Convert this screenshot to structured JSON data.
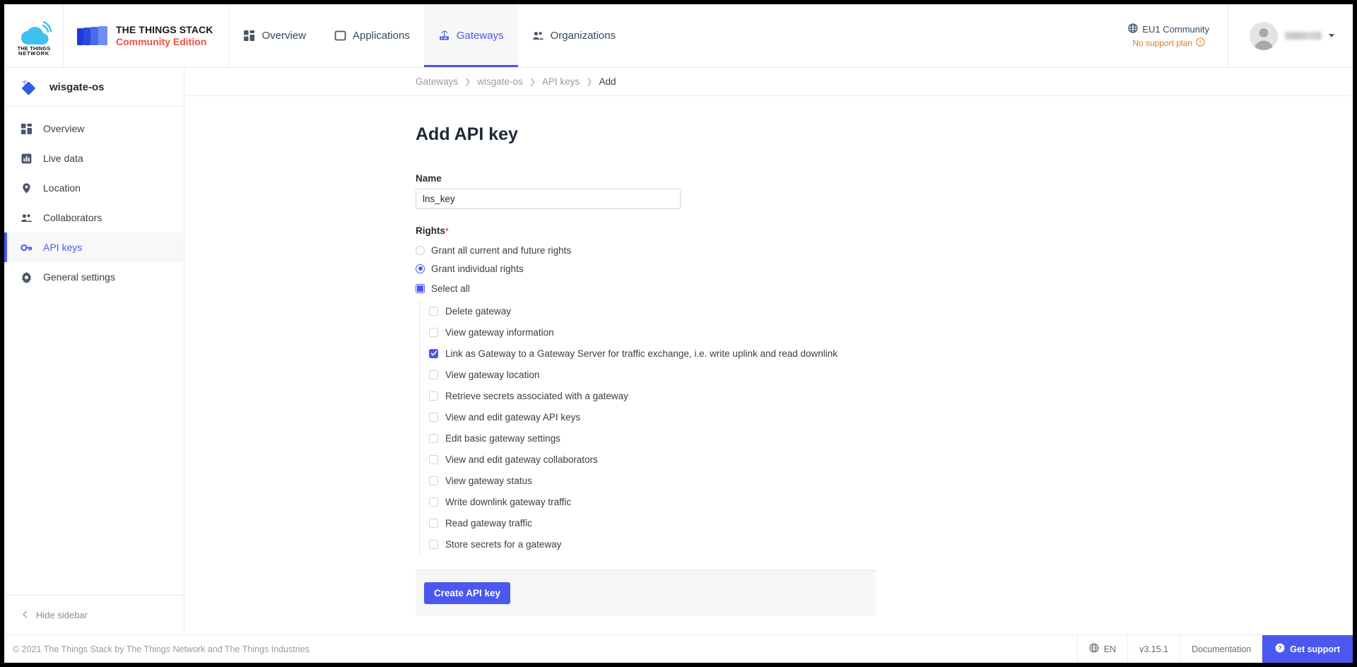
{
  "header": {
    "brand_logo_name": "the-things-network-logo",
    "brand_logo_line1": "THE THINGS",
    "brand_logo_line2": "NETWORK",
    "stack_logo_line1": "THE THINGS STACK",
    "stack_logo_line2": "Community Edition",
    "nav": [
      {
        "label": "Overview",
        "icon": "overview-grid-icon",
        "active": false
      },
      {
        "label": "Applications",
        "icon": "application-square-icon",
        "active": false
      },
      {
        "label": "Gateways",
        "icon": "gateway-router-icon",
        "active": true
      },
      {
        "label": "Organizations",
        "icon": "organizations-people-icon",
        "active": false
      }
    ],
    "cluster": {
      "icon": "globe-icon",
      "name": "EU1 Community",
      "support_plan": "No support plan",
      "help_icon": "question-circle-icon"
    },
    "user": {
      "avatar_icon": "avatar-icon",
      "name_redacted": true,
      "caret_icon": "chevron-down-icon"
    }
  },
  "sidebar": {
    "entity_icon": "gateway-diamond-icon",
    "entity_name": "wisgate-os",
    "items": [
      {
        "label": "Overview",
        "icon": "overview-grid-icon",
        "active": false
      },
      {
        "label": "Live data",
        "icon": "live-data-chart-icon",
        "active": false
      },
      {
        "label": "Location",
        "icon": "location-pin-icon",
        "active": false
      },
      {
        "label": "Collaborators",
        "icon": "collaborators-people-icon",
        "active": false
      },
      {
        "label": "API keys",
        "icon": "key-icon",
        "active": true
      },
      {
        "label": "General settings",
        "icon": "gear-icon",
        "active": false
      }
    ],
    "hide_label": "Hide sidebar",
    "hide_icon": "chevron-left-icon"
  },
  "breadcrumb": [
    {
      "label": "Gateways",
      "last": false
    },
    {
      "label": "wisgate-os",
      "last": false
    },
    {
      "label": "API keys",
      "last": false
    },
    {
      "label": "Add",
      "last": true
    }
  ],
  "main": {
    "page_title": "Add API key",
    "name_label": "Name",
    "name_value": "lns_key",
    "name_placeholder": "",
    "rights_label": "Rights",
    "rights_required_marker": "*",
    "radio_options": [
      {
        "label": "Grant all current and future rights",
        "checked": false
      },
      {
        "label": "Grant individual rights",
        "checked": true
      }
    ],
    "select_all_label": "Select all",
    "select_all_state": "indeterminate",
    "rights": [
      {
        "label": "Delete gateway",
        "checked": false
      },
      {
        "label": "View gateway information",
        "checked": false
      },
      {
        "label": "Link as Gateway to a Gateway Server for traffic exchange, i.e. write uplink and read downlink",
        "checked": true
      },
      {
        "label": "View gateway location",
        "checked": false
      },
      {
        "label": "Retrieve secrets associated with a gateway",
        "checked": false
      },
      {
        "label": "View and edit gateway API keys",
        "checked": false
      },
      {
        "label": "Edit basic gateway settings",
        "checked": false
      },
      {
        "label": "View and edit gateway collaborators",
        "checked": false
      },
      {
        "label": "View gateway status",
        "checked": false
      },
      {
        "label": "Write downlink gateway traffic",
        "checked": false
      },
      {
        "label": "Read gateway traffic",
        "checked": false
      },
      {
        "label": "Store secrets for a gateway",
        "checked": false
      }
    ],
    "submit_label": "Create API key"
  },
  "footer": {
    "copyright": "© 2021 The Things Stack by The Things Network and The Things Industries",
    "language": "EN",
    "language_icon": "globe-icon",
    "version": "v3.15.1",
    "documentation": "Documentation",
    "support": "Get support",
    "support_icon": "question-circle-icon"
  },
  "colors": {
    "accent": "#4a58f0",
    "warning": "#e07b1d",
    "required": "#ef4e63",
    "brand_red": "#ef4e48"
  }
}
